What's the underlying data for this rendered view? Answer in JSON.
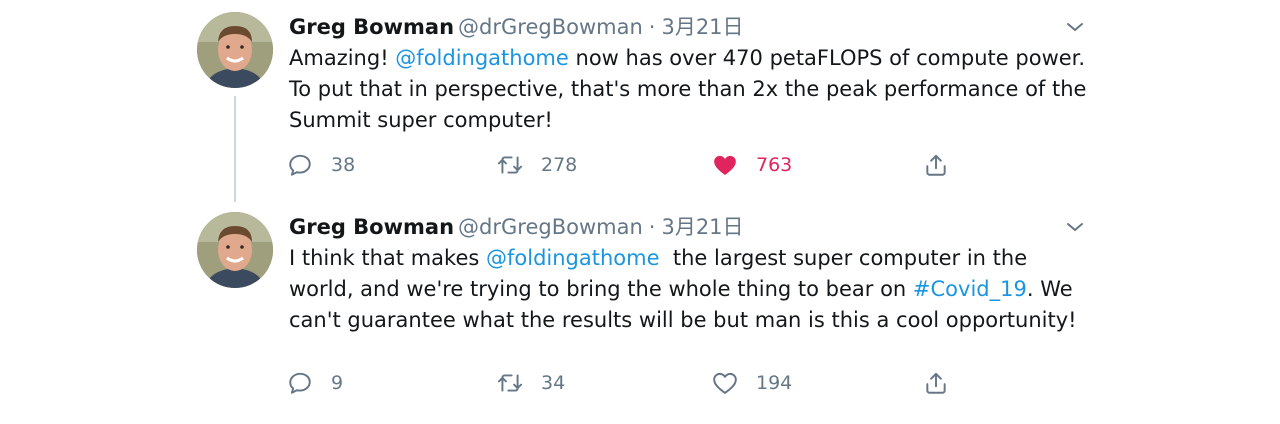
{
  "tweets": [
    {
      "name": "Greg Bowman",
      "handle": "@drGregBowman",
      "separator": "·",
      "date": "3月21日",
      "text_parts": [
        "Amazing! ",
        "@foldingathome",
        " now has over 470 petaFLOPS of compute power. To put that in perspective, that's more than 2x the peak performance of the Summit super computer!"
      ],
      "replies": "38",
      "retweets": "278",
      "likes": "763",
      "liked": true
    },
    {
      "name": "Greg Bowman",
      "handle": "@drGregBowman",
      "separator": "·",
      "date": "3月21日",
      "text_parts": [
        "I think that makes ",
        "@foldingathome",
        "  the largest super computer in the world, and we're trying to bring the whole thing to bear on ",
        "#Covid_19",
        ". We can't guarantee what the results will be but man is this a cool opportunity!"
      ],
      "replies": "9",
      "retweets": "34",
      "likes": "194",
      "liked": false
    }
  ],
  "colors": {
    "link": "#1b95e0",
    "like": "#e0245e",
    "muted": "#657786",
    "thread_line": "#ccd6dd"
  },
  "icons": [
    "avatar",
    "chevron-down-icon",
    "reply-icon",
    "retweet-icon",
    "like-icon",
    "share-icon"
  ]
}
